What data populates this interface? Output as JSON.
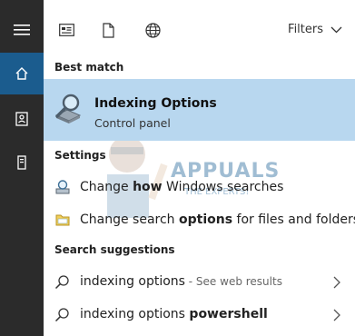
{
  "topbar": {
    "filters_label": "Filters"
  },
  "sections": {
    "best_match": "Best match",
    "settings": "Settings",
    "suggestions": "Search suggestions"
  },
  "best_match": {
    "title": "Indexing Options",
    "subtitle": "Control panel"
  },
  "settings": [
    {
      "pre": "Change ",
      "bold": "how",
      "post": " Windows searches"
    },
    {
      "pre": "Change search ",
      "bold": "options",
      "post": " for files and folders"
    }
  ],
  "suggestions": [
    {
      "text": "indexing options",
      "note": " - See web results",
      "bold": ""
    },
    {
      "text": "indexing options ",
      "note": "",
      "bold": "powershell"
    }
  ],
  "watermark": {
    "title": "APPUALS",
    "subtitle": "THE EXPERTS!"
  },
  "colors": {
    "rail": "#2b2b2b",
    "rail_active": "#1b5c8e",
    "selection": "#b8d7ef"
  }
}
